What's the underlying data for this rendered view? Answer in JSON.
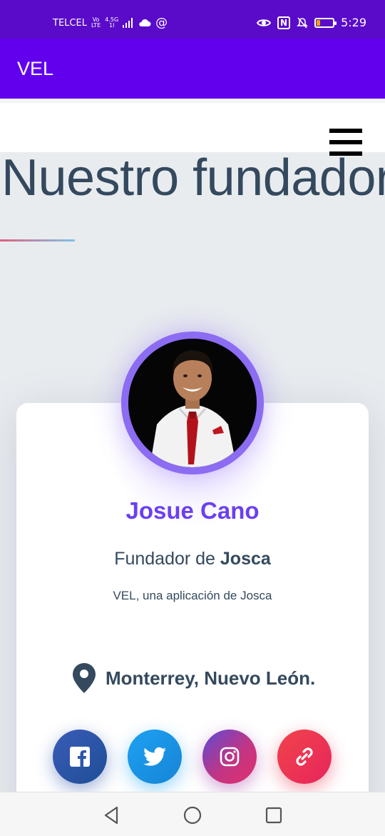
{
  "status_bar": {
    "carrier": "TELCEL",
    "volte_top": "Vo",
    "volte_bottom": "LTE",
    "network_top": "4.5G",
    "network_bottom": "1l",
    "at_symbol": "@",
    "nfc_label": "N",
    "time": "5:29",
    "battery_color": "#f2a600"
  },
  "app_bar": {
    "title": "VEL",
    "color": "#6200ee"
  },
  "page": {
    "section_title": "Nuestro fundador"
  },
  "profile": {
    "name": "Josue Cano",
    "role_prefix": "Fundador de ",
    "role_company": "Josca",
    "tagline": "VEL, una aplicación de Josca",
    "location": "Monterrey, Nuevo León.",
    "accent_color": "#6b3ff0"
  },
  "social": [
    {
      "name": "facebook",
      "icon": "facebook-icon"
    },
    {
      "name": "twitter",
      "icon": "twitter-icon"
    },
    {
      "name": "instagram",
      "icon": "instagram-icon"
    },
    {
      "name": "link",
      "icon": "link-icon"
    }
  ],
  "nav": [
    "back-icon",
    "home-icon",
    "recents-icon"
  ]
}
